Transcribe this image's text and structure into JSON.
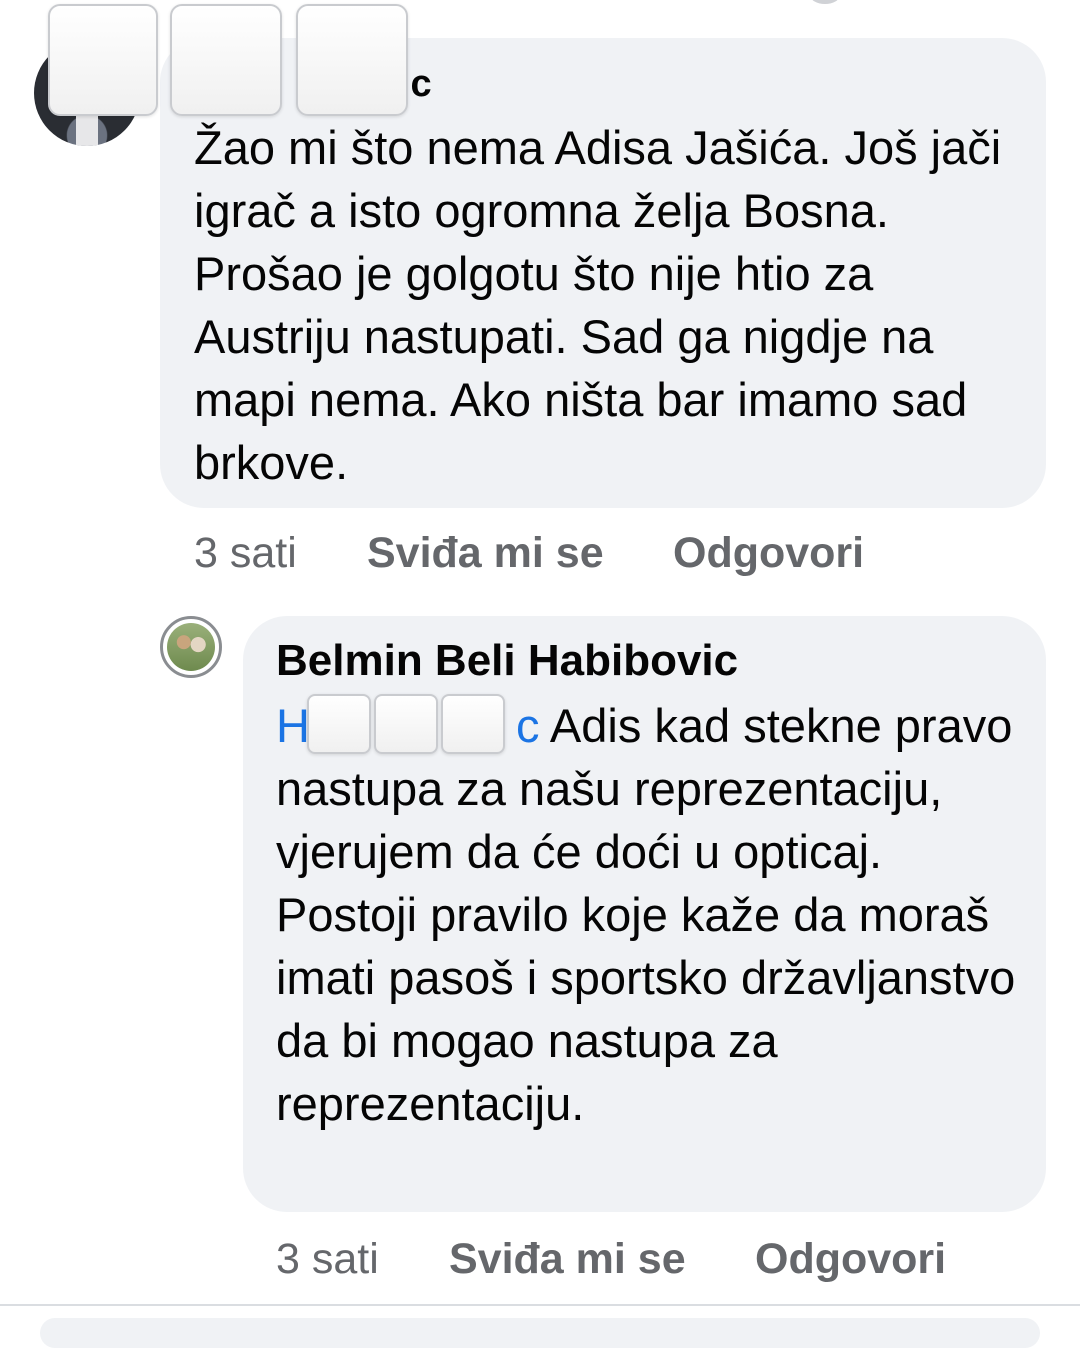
{
  "comments": [
    {
      "author_visible": "ic",
      "text": "Žao mi što nema Adisa Jašića. Još jači igrač a isto ogromna želja Bosna. Prošao je golgotu što nije htio za Austriju nastupati. Sad ga nigdje na mapi nema. Ako ništa bar imamo sad brkove.",
      "time": "3 sati",
      "like_label": "Sviđa mi se",
      "reply_label": "Odgovori"
    },
    {
      "author": "Belmin Beli Habibovic",
      "mention_start": "H",
      "mention_end": "c",
      "text": " Adis kad stekne pravo nastupa za našu reprezentaciju, vjerujem da će doći u opticaj. Postoji pravilo koje kaže da moraš imati pasoš i sportsko državljanstvo da bi mogao nastupa za reprezentaciju.",
      "time": "3 sati",
      "like_label": "Sviđa mi se",
      "reply_label": "Odgovori"
    }
  ]
}
